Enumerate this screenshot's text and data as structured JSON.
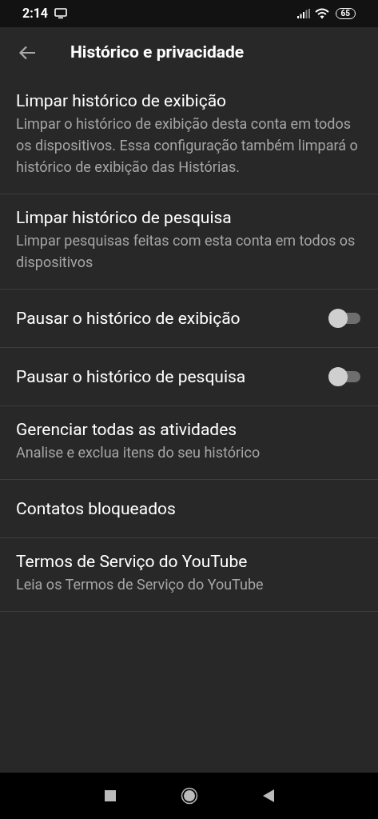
{
  "status_bar": {
    "time": "2:14",
    "battery": "65"
  },
  "app_bar": {
    "title": "Histórico e privacidade"
  },
  "settings": [
    {
      "kind": "text",
      "title": "Limpar histórico de exibição",
      "description": "Limpar o histórico de exibição desta conta em todos os dispositivos. Essa configuração também limpará o histórico de exibição das Histórias."
    },
    {
      "kind": "text",
      "title": "Limpar histórico de pesquisa",
      "description": "Limpar pesquisas feitas com esta conta em todos os dispositivos"
    },
    {
      "kind": "toggle",
      "title": "Pausar o histórico de exibição",
      "on": false
    },
    {
      "kind": "toggle",
      "title": "Pausar o histórico de pesquisa",
      "on": false
    },
    {
      "kind": "text",
      "title": "Gerenciar todas as atividades",
      "description": "Analise e exclua itens do seu histórico"
    },
    {
      "kind": "text",
      "title": "Contatos bloqueados"
    },
    {
      "kind": "text",
      "title": "Termos de Serviço do YouTube",
      "description": "Leia os Termos de Serviço do YouTube"
    }
  ]
}
